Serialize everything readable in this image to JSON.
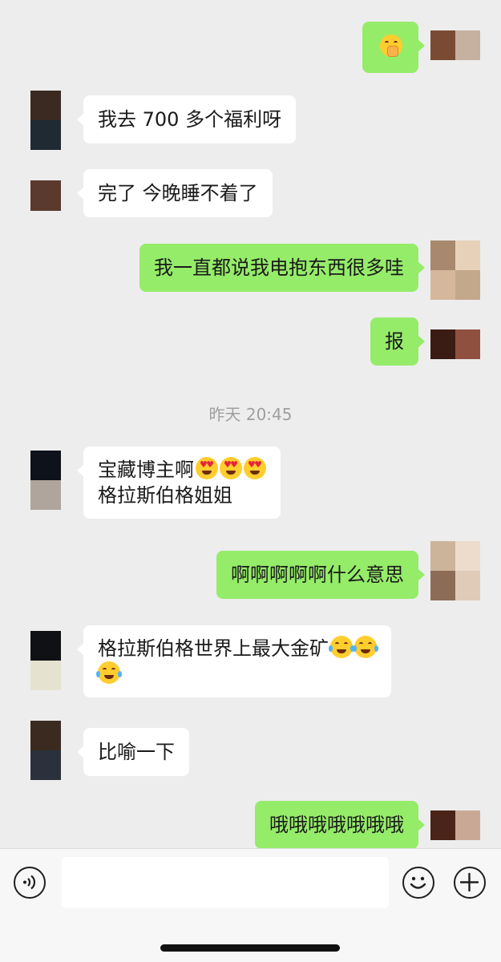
{
  "colors": {
    "background": "#ededed",
    "incoming_bubble": "#ffffff",
    "outgoing_bubble": "#95ec69",
    "text": "#1a1a1a",
    "timestamp_text": "#9f9f9f"
  },
  "messages": [
    {
      "side": "right",
      "lines": [
        ""
      ],
      "emoji": [
        "face-with-hand-over-mouth"
      ]
    },
    {
      "side": "left",
      "lines": [
        "我去 700 多个福利呀"
      ]
    },
    {
      "side": "left",
      "lines": [
        "完了 今晚睡不着了"
      ]
    },
    {
      "side": "right",
      "lines": [
        "我一直都说我电抱东西很多哇"
      ]
    },
    {
      "side": "right",
      "lines": [
        "报"
      ]
    },
    {
      "side": "left",
      "lines": [
        "宝藏博主啊",
        "格拉斯伯格姐姐"
      ],
      "emoji": [
        "heart-eyes",
        "heart-eyes",
        "heart-eyes"
      ]
    },
    {
      "side": "right",
      "lines": [
        "啊啊啊啊啊什么意思"
      ]
    },
    {
      "side": "left",
      "lines": [
        "格拉斯伯格世界上最大金矿",
        ""
      ],
      "emoji": [
        "tears-of-joy",
        "tears-of-joy",
        "tears-of-joy"
      ]
    },
    {
      "side": "left",
      "lines": [
        "比喻一下"
      ]
    },
    {
      "side": "right",
      "lines": [
        "哦哦哦哦哦哦哦"
      ]
    }
  ],
  "timestamp": "昨天 20:45",
  "input_bar": {
    "voice_icon": "voice-icon",
    "emoji_icon": "smiley-icon",
    "plus_icon": "plus-icon",
    "input_value": ""
  }
}
